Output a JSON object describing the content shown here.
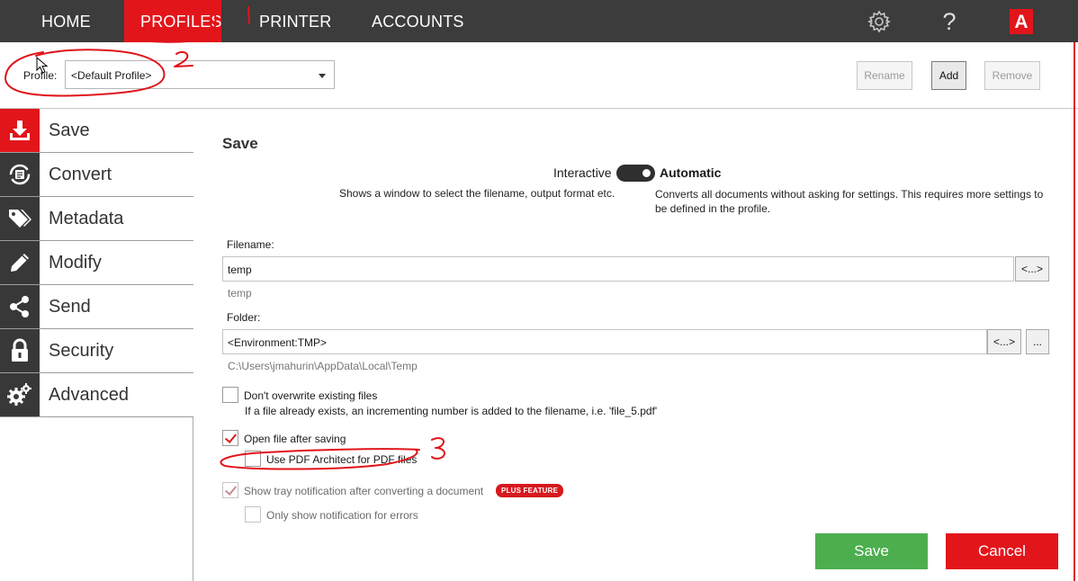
{
  "nav": {
    "items": [
      {
        "label": "HOME"
      },
      {
        "label": "PROFILES"
      },
      {
        "label": "PRINTER"
      },
      {
        "label": "ACCOUNTS"
      }
    ],
    "icons": {
      "settings": "gear-icon",
      "help_glyph": "?",
      "logo_glyph": "A"
    }
  },
  "profile": {
    "label": "Profile:",
    "selected": "<Default Profile>",
    "rename": "Rename",
    "add": "Add",
    "remove": "Remove"
  },
  "sidebar": {
    "items": [
      {
        "label": "Save",
        "icon": "download-icon"
      },
      {
        "label": "Convert",
        "icon": "convert-icon"
      },
      {
        "label": "Metadata",
        "icon": "tags-icon"
      },
      {
        "label": "Modify",
        "icon": "pencil-icon"
      },
      {
        "label": "Send",
        "icon": "share-icon"
      },
      {
        "label": "Security",
        "icon": "lock-icon"
      },
      {
        "label": "Advanced",
        "icon": "gears-icon"
      }
    ]
  },
  "main": {
    "title": "Save",
    "mode": {
      "left": "Interactive",
      "right": "Automatic",
      "left_desc": "Shows a window to select the filename, output format etc.",
      "right_desc": "Converts all documents without asking for settings. This requires more settings to be defined in the profile."
    },
    "filename": {
      "label": "Filename:",
      "value": "temp",
      "token_button": "<...>",
      "preview": "temp"
    },
    "folder": {
      "label": "Folder:",
      "value": "<Environment:TMP>",
      "token_button": "<...>",
      "browse_button": "...",
      "preview": "C:\\Users\\jmahurin\\AppData\\Local\\Temp"
    },
    "options": {
      "dont_overwrite": "Don't overwrite existing files",
      "dont_overwrite_desc": "If a file already exists, an incrementing number is added to the filename, i.e. 'file_5.pdf'",
      "open_after_saving": "Open file after saving",
      "use_pdf_architect": "Use PDF Architect for PDF files",
      "show_tray": "Show tray notification after converting a document",
      "plus_badge": "PLUS FEATURE",
      "only_errors": "Only show notification for errors"
    },
    "save_button": "Save",
    "cancel_button": "Cancel"
  },
  "annotations": [
    "1",
    "2",
    "3"
  ]
}
